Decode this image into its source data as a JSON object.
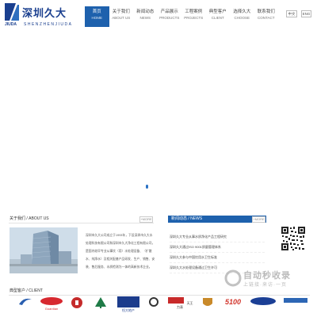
{
  "header": {
    "logo": {
      "name_cn": "深圳久大",
      "brand": "JIUDA",
      "name_en": "SHENZHENJIUDA"
    },
    "nav": [
      {
        "cn": "首页",
        "en": "HOME"
      },
      {
        "cn": "关于我们",
        "en": "ABOUT US"
      },
      {
        "cn": "新闻动态",
        "en": "NEWS"
      },
      {
        "cn": "产品展示",
        "en": "PRODUCTS"
      },
      {
        "cn": "工程案例",
        "en": "PROJECTS"
      },
      {
        "cn": "典型客户",
        "en": "CLIENT"
      },
      {
        "cn": "选择久大",
        "en": "CHOOSE"
      },
      {
        "cn": "联系我们",
        "en": "CONTACT"
      }
    ],
    "active_index": 0,
    "lang": {
      "cn": "中文",
      "en": "ENG"
    }
  },
  "about": {
    "title": "关于我们 / ABOUT US",
    "more": "+MORE",
    "text": "深圳市久大公司成立于1993年，下设深圳市久大水处理科技有限公司和深圳市久大净化工程有限公司，是国内较早专业从事饮（用）水处理设备、（扩散水、纯净水）及相关配套产品研发、生产、销售、安装、售后服务、水质检测为一体的高新技术企业。"
  },
  "news": {
    "title": "新闻动态 / NEWS",
    "more": "+MORE",
    "items": [
      "深圳久大专业从事水质净化产品工程研究",
      "深圳久大通过ISO 9001质量管理体系",
      "深圳久大参与中国饮用水卫生标准",
      "深圳久大水处理设备通过卫生许可"
    ]
  },
  "clients": {
    "title": "典型客户 / CLIENT",
    "logos": [
      {
        "name": "logo-swirl",
        "label": ""
      },
      {
        "name": "logo-guardian",
        "label": "Guardian"
      },
      {
        "name": "logo-bank",
        "label": ""
      },
      {
        "name": "logo-tree",
        "label": ""
      },
      {
        "name": "logo-hengda",
        "label": "恒大地产"
      },
      {
        "name": "logo-mark-c",
        "label": ""
      },
      {
        "name": "logo-tianwang",
        "label": "天王力表"
      },
      {
        "name": "logo-crest",
        "label": ""
      },
      {
        "name": "logo-5100",
        "label": "5100"
      },
      {
        "name": "logo-samsung",
        "label": ""
      },
      {
        "name": "logo-blue",
        "label": ""
      }
    ]
  },
  "watermark": {
    "text": "自动秒收录",
    "sub": "上链接·来访·一页"
  },
  "colors": {
    "brand_blue": "#1e61ad",
    "logo_blue": "#1a3f8f"
  }
}
